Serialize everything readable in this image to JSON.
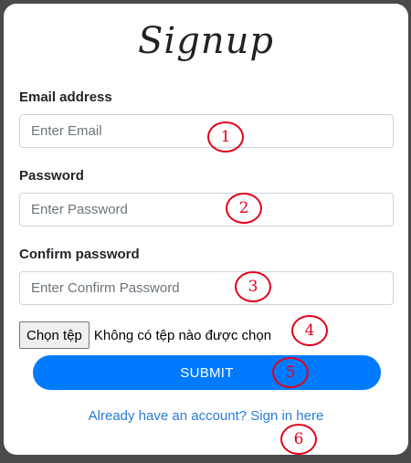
{
  "form": {
    "title": "Signup",
    "email_label": "Email address",
    "email_placeholder": "Enter Email",
    "password_label": "Password",
    "password_placeholder": "Enter Password",
    "confirm_label": "Confirm password",
    "confirm_placeholder": "Enter Confirm Password",
    "file_button": "Chọn tệp",
    "file_status": "Không có tệp nào được chọn",
    "submit_label": "SUBMIT",
    "signin_link": "Already have an account? Sign in here"
  },
  "annotations": [
    "1",
    "2",
    "3",
    "4",
    "5",
    "6"
  ],
  "colors": {
    "primary": "#007bff",
    "link": "#2b7bd6",
    "annotation": "#e2001a",
    "backdrop": "#4a4a4a"
  }
}
